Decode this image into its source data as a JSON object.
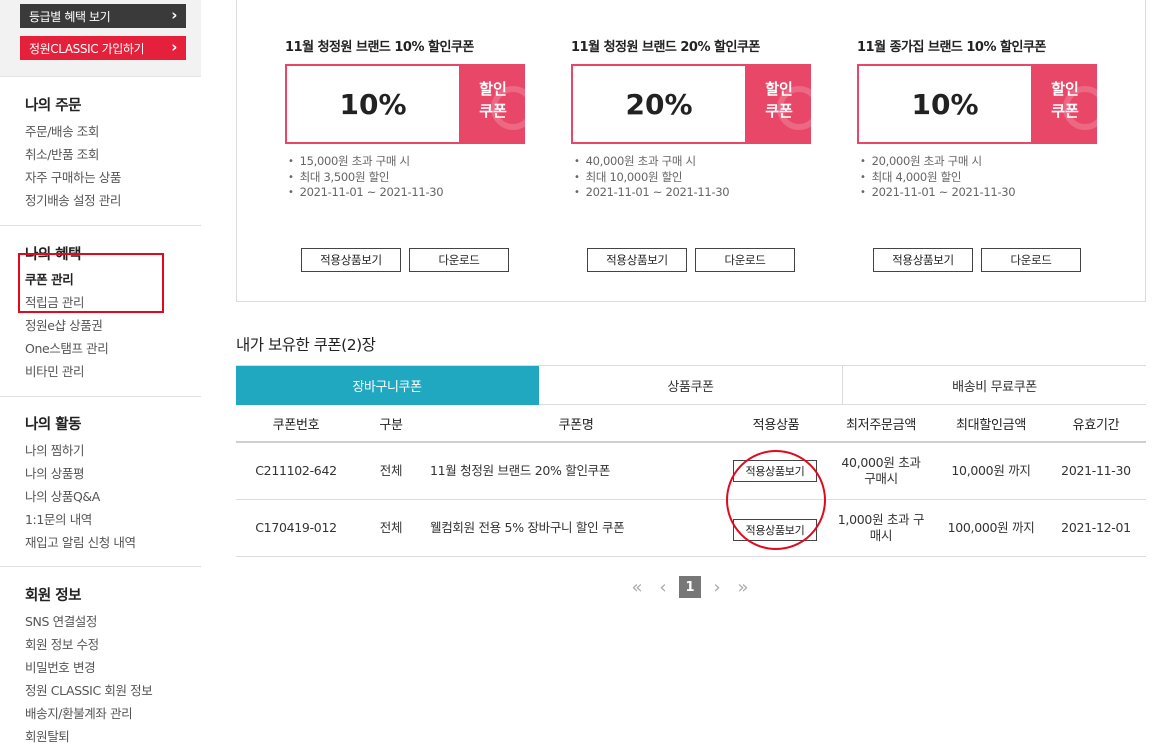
{
  "sidebar": {
    "grade_button": "등급별 혜택 보기",
    "classic_button": "정원CLASSIC 가입하기",
    "sections": [
      {
        "title": "나의 주문",
        "items": [
          "주문/배송 조회",
          "취소/반품 조회",
          "자주 구매하는 상품",
          "정기배송 설정 관리"
        ]
      },
      {
        "title": "나의 혜택",
        "items": [
          "쿠폰 관리",
          "적립금 관리",
          "정원e샵 상품권",
          "One스탬프 관리",
          "비타민 관리"
        ]
      },
      {
        "title": "나의 활동",
        "items": [
          "나의 찜하기",
          "나의 상품평",
          "나의 상품Q&A",
          "1:1문의 내역",
          "재입고 알림 신청 내역"
        ]
      },
      {
        "title": "회원 정보",
        "items": [
          "SNS 연결설정",
          "회원 정보 수정",
          "비밀번호 변경",
          "정원 CLASSIC 회원 정보",
          "배송지/환불계좌 관리",
          "회원탈퇴"
        ]
      }
    ]
  },
  "coupons": [
    {
      "title": "11월 청정원 브랜드 10% 할인쿠폰",
      "percent": "10%",
      "stub_line1": "할인",
      "stub_line2": "쿠폰",
      "lines": [
        "15,000원 초과 구매 시",
        "최대 3,500원 할인",
        "2021-11-01 ~ 2021-11-30"
      ],
      "view_button": "적용상품보기",
      "download_button": "다운로드"
    },
    {
      "title": "11월 청정원 브랜드 20% 할인쿠폰",
      "percent": "20%",
      "stub_line1": "할인",
      "stub_line2": "쿠폰",
      "lines": [
        "40,000원 초과 구매 시",
        "최대 10,000원 할인",
        "2021-11-01 ~ 2021-11-30"
      ],
      "view_button": "적용상품보기",
      "download_button": "다운로드"
    },
    {
      "title": "11월 종가집 브랜드 10% 할인쿠폰",
      "percent": "10%",
      "stub_line1": "할인",
      "stub_line2": "쿠폰",
      "lines": [
        "20,000원 초과 구매 시",
        "최대 4,000원 할인",
        "2021-11-01 ~ 2021-11-30"
      ],
      "view_button": "적용상품보기",
      "download_button": "다운로드"
    }
  ],
  "owned": {
    "title": "내가 보유한 쿠폰(2)장",
    "tabs": [
      "장바구니쿠폰",
      "상품쿠폰",
      "배송비 무료쿠폰"
    ],
    "columns": [
      "쿠폰번호",
      "구분",
      "쿠폰명",
      "적용상품",
      "최저주문금액",
      "최대할인금액",
      "유효기간"
    ],
    "rows": [
      {
        "no": "C211102-642",
        "type": "전체",
        "name": "11월 청정원 브랜드 20% 할인쿠폰",
        "button": "적용상품보기",
        "min_order": "40,000원 초과 구매시",
        "max_discount": "10,000원 까지",
        "expiry": "2021-11-30"
      },
      {
        "no": "C170419-012",
        "type": "전체",
        "name": "웰컴회원 전용 5% 장바구니 할인 쿠폰",
        "button": "적용상품보기",
        "min_order": "1,000원 초과 구매시",
        "max_discount": "100,000원 까지",
        "expiry": "2021-12-01"
      }
    ]
  },
  "pagination": {
    "first": "«",
    "prev": "‹",
    "current": "1",
    "next": "›",
    "last": "»"
  },
  "colors": {
    "accent_pink": "#e94768",
    "tab_active": "#1fa8bf",
    "classic_red": "#e5203a",
    "annotation_red": "#e00a1e"
  }
}
